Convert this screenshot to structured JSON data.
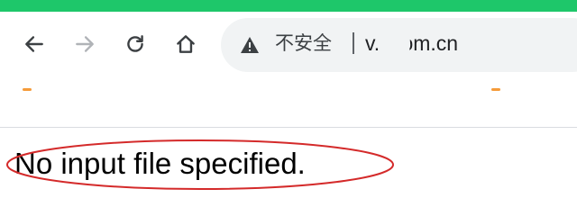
{
  "browser": {
    "accent_color": "#1ec76a",
    "toolbar": {
      "back_icon": "arrow-left-icon",
      "forward_icon": "arrow-right-icon",
      "reload_icon": "reload-icon",
      "home_icon": "home-icon"
    },
    "omnibox": {
      "security_icon": "warning-triangle-icon",
      "security_label": "不安全",
      "url": "v.  .com.cn",
      "background_color": "#f1f3f4"
    },
    "bookmark_marker_color": "#f59b3a"
  },
  "page": {
    "message": "No input file specified.",
    "annotation_color": "#d42a2a"
  }
}
